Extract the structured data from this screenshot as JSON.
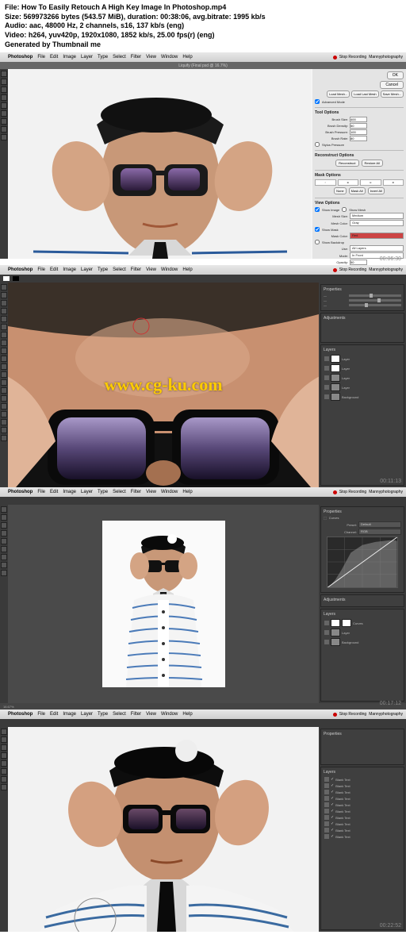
{
  "metadata": {
    "file": "File: How To Easily Retouch A High Key Image In Photoshop.mp4",
    "size": "Size: 569973266 bytes (543.57 MiB), duration: 00:38:06, avg.bitrate: 1995 kb/s",
    "audio": "Audio: aac, 48000 Hz, 2 channels, s16, 137 kb/s (eng)",
    "video": "Video: h264, yuv420p, 1920x1080, 1852 kb/s, 25.00 fps(r) (eng)",
    "generated": "Generated by Thumbnail me"
  },
  "macmenu": {
    "app": "Photoshop",
    "items": [
      "File",
      "Edit",
      "Image",
      "Layer",
      "Type",
      "Select",
      "Filter",
      "View",
      "Window",
      "Help"
    ],
    "right_recording": "Stop Recording",
    "right_project": "Mannyphotography"
  },
  "frame1": {
    "doc_title": "Liquify (Final psd @ 16.7%)",
    "timestamp": "00:06:30",
    "liquify": {
      "ok": "OK",
      "cancel": "Cancel",
      "load_mesh": "Load Mesh...",
      "load_last_mesh": "Load Last Mesh",
      "save_mesh": "Save Mesh...",
      "advanced": "Advanced Mode",
      "tool_options": "Tool Options",
      "brush_size_lbl": "Brush Size:",
      "brush_size": "400",
      "brush_density_lbl": "Brush Density:",
      "brush_density": "50",
      "brush_pressure_lbl": "Brush Pressure:",
      "brush_pressure": "100",
      "brush_rate_lbl": "Brush Rate:",
      "brush_rate": "80",
      "stylus": "Stylus Pressure",
      "reconstruct_options": "Reconstruct Options",
      "reconstruct": "Reconstruct",
      "restore_all": "Restore All",
      "mask_options": "Mask Options",
      "none": "None",
      "mask_all": "Mask All",
      "invert_all": "Invert All",
      "view_options": "View Options",
      "show_image": "Show Image",
      "show_mesh": "Show Mesh",
      "mesh_size_lbl": "Mesh Size:",
      "mesh_size": "Medium",
      "mesh_color_lbl": "Mesh Color:",
      "mesh_color": "Gray",
      "show_mask": "Show Mask",
      "mask_color_lbl": "Mask Color:",
      "mask_color": "Red",
      "show_backdrop": "Show Backdrop",
      "use_lbl": "Use:",
      "use": "All Layers",
      "mode_lbl": "Mode:",
      "mode": "In Front",
      "opacity_lbl": "Opacity:",
      "opacity": "50"
    }
  },
  "frame2": {
    "timestamp": "00:11:13",
    "properties": "Properties",
    "adjustments": "Adjustments",
    "layers": "Layers",
    "cursor": "○"
  },
  "frame3": {
    "timestamp": "00:17:12",
    "properties": "Properties",
    "curves": "Curves",
    "preset_lbl": "Preset:",
    "preset": "Default",
    "channel_lbl": "Channel:",
    "channel": "RGB",
    "adjustments": "Adjustments",
    "layers": "Layers",
    "zoom": "16.67%"
  },
  "frame4": {
    "timestamp": "00:22:52",
    "properties": "Properties",
    "layers": "Layers",
    "layer_label": "Blank Text"
  },
  "watermark": "www.cg-ku.com"
}
